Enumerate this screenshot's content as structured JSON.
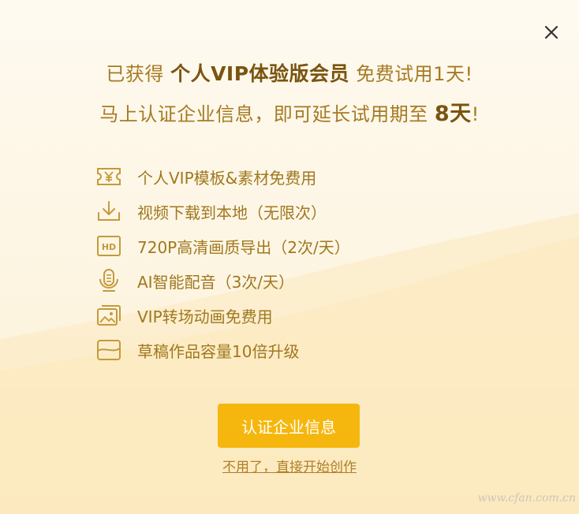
{
  "dialog": {
    "headline_line1": {
      "prefix": "已获得",
      "emphasis": "个人VIP体验版会员",
      "suffix": "免费试用1天!"
    },
    "headline_line2": {
      "prefix": "马上认证企业信息，即可延长试用期至",
      "emphasis": "8天",
      "suffix": "!"
    },
    "features": [
      {
        "icon": "ticket-yen-icon",
        "label": "个人VIP模板&素材免费用"
      },
      {
        "icon": "download-icon",
        "label": "视频下载到本地（无限次）"
      },
      {
        "icon": "hd-icon",
        "label": "720P高清画质导出（2次/天）"
      },
      {
        "icon": "microphone-icon",
        "label": "AI智能配音（3次/天）"
      },
      {
        "icon": "image-stack-icon",
        "label": "VIP转场动画免费用"
      },
      {
        "icon": "draft-box-icon",
        "label": "草稿作品容量10倍升级"
      }
    ],
    "cta_label": "认证企业信息",
    "skip_label": "不用了，直接开始创作",
    "close_icon": "close-icon"
  },
  "watermark": "www.cfan.com.cn",
  "colors": {
    "accent": "#f5b70d",
    "text_gold": "#a67a24",
    "text_dark_gold": "#7a5410",
    "icon_stroke": "#c49a3c"
  }
}
